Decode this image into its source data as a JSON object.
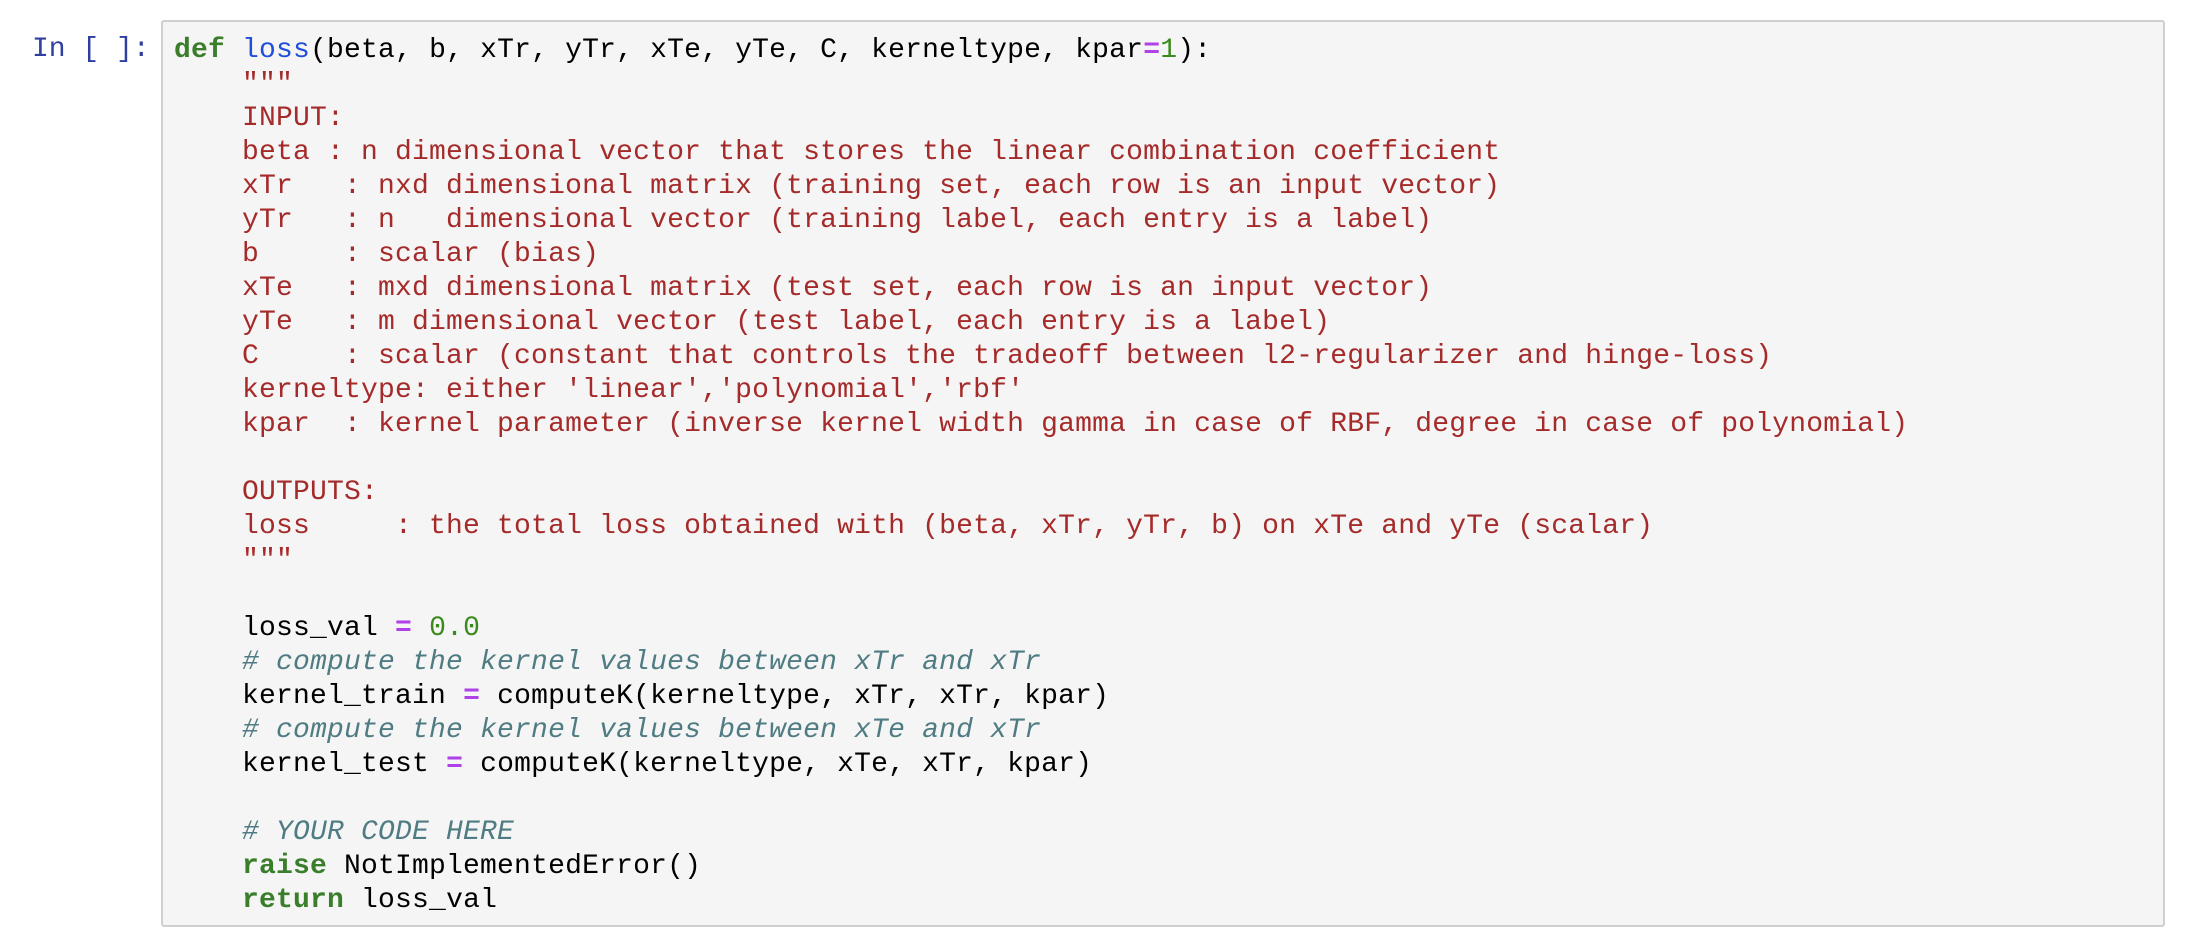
{
  "cell": {
    "prompt": "In [ ]:",
    "type": "code"
  },
  "code": {
    "def_keyword": "def",
    "function_name": "loss",
    "signature_args": "(beta, b, xTr, yTr, xTe, yTe, C, kerneltype, kpar",
    "signature_eq": "=",
    "signature_default": "1",
    "signature_end": "):",
    "indent": "    ",
    "docstring_lines": [
      "\"\"\"",
      "INPUT:",
      "beta : n dimensional vector that stores the linear combination coefficient",
      "xTr   : nxd dimensional matrix (training set, each row is an input vector)",
      "yTr   : n   dimensional vector (training label, each entry is a label)",
      "b     : scalar (bias)",
      "xTe   : mxd dimensional matrix (test set, each row is an input vector)",
      "yTe   : m dimensional vector (test label, each entry is a label)",
      "C     : scalar (constant that controls the tradeoff between l2-regularizer and hinge-loss)",
      "kerneltype: either 'linear','polynomial','rbf'",
      "kpar  : kernel parameter (inverse kernel width gamma in case of RBF, degree in case of polynomial)",
      "",
      "OUTPUTS:",
      "loss     : the total loss obtained with (beta, xTr, yTr, b) on xTe and yTe (scalar)",
      "\"\"\""
    ],
    "loss_val_var": "loss_val ",
    "assign_op": "=",
    "loss_val_init": " 0.0",
    "comment_train": "# compute the kernel values between xTr and xTr",
    "kernel_train_var": "kernel_train ",
    "kernel_train_call": " computeK(kerneltype, xTr, xTr, kpar)",
    "comment_test": "# compute the kernel values between xTe and xTr",
    "kernel_test_var": "kernel_test ",
    "kernel_test_call": " computeK(kerneltype, xTe, xTr, kpar)",
    "comment_your_code": "# YOUR CODE HERE",
    "raise_keyword": "raise",
    "raise_expr": " NotImplementedError()",
    "return_keyword": "return",
    "return_expr": " loss_val"
  },
  "colors": {
    "prompt": "#303f9f",
    "keyword": "#3a7d2b",
    "function": "#1f4fd8",
    "operator": "#b040e8",
    "number": "#3a8a1e",
    "string": "#a52a2a",
    "comment": "#4f7c82",
    "cell_background": "#f5f5f5",
    "cell_border": "#cfcfcf"
  }
}
